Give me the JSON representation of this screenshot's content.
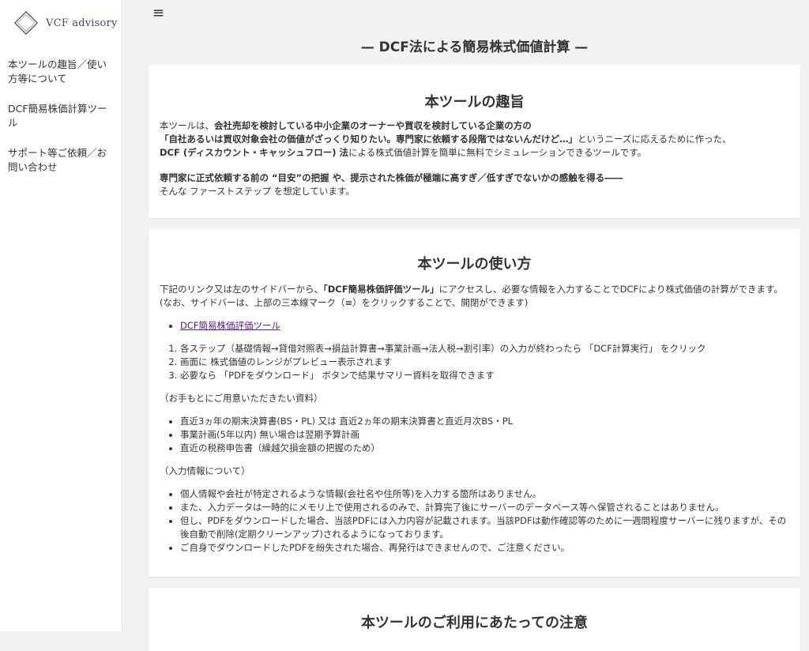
{
  "brand": {
    "name": "VCF advisory"
  },
  "menu_icon": "≡",
  "sidebar": {
    "items": [
      {
        "label": "本ツールの趣旨／使い方等について"
      },
      {
        "label": "DCF簡易株価計算ツール"
      },
      {
        "label": "サポート等ご依頼／お問い合わせ"
      }
    ]
  },
  "page_title": "— DCF法による簡易株式価値計算 —",
  "purpose": {
    "title": "本ツールの趣旨",
    "line1_pre": "本ツールは、",
    "line1_bold": "会社売却を検討している中小企業のオーナーや買収を検討している企業の方の",
    "line2_bold": "「自社あるいは買収対象会社の価値がざっくり知りたい。専門家に依頼する段階ではないんだけど…」",
    "line2_post": "というニーズに応えるために作った、",
    "line3_bold": "DCF (ディスカウント・キャッシュフロー) 法",
    "line3_post": "による株式価値計算を簡単に無料でシミュレーションできるツールです。",
    "note_bold": "専門家に正式依頼する前の “目安”の把握 や、提示された株価が極端に高すぎ／低すぎでないかの感触を得る――",
    "note_line2": "そんな ファーストステップ を想定しています。"
  },
  "howto": {
    "title": "本ツールの使い方",
    "lead_pre": "下記のリンク又は左のサイドバーから、",
    "lead_bold": "「DCF簡易株価評価ツール」",
    "lead_post": "にアクセスし、必要な情報を入力することでDCFにより株式価値の計算ができます。(なお、サイドバーは、上部の三本線マーク（≡）をクリックすることで、開閉ができます)",
    "link_label": "DCF簡易株価評価ツール",
    "steps": [
      "各ステップ（基礎情報→貸借対照表→損益計算書→事業計画→法人税→割引率）の入力が終わったら 「DCF計算実行」 をクリック",
      "画面に 株式価値のレンジがプレビュー表示されます",
      "必要なら 「PDFをダウンロード」 ボタンで結果サマリー資料を取得できます"
    ],
    "materials_heading": "（お手もとにご用意いただきたい資料）",
    "materials": [
      "直近3ヵ年の期末決算書(BS・PL) 又は 直近2ヵ年の期末決算書と直近月次BS・PL",
      "事業計画(5年以内) 無い場合は翌期予算計画",
      "直近の税務申告書（繰越欠損金額の把握のため）"
    ],
    "input_heading": "（入力情報について）",
    "input_notes": [
      "個人情報や会社が特定されるような情報(会社名や住所等)を入力する箇所はありません。",
      "また、入力データは一時的にメモリ上で使用されるのみで、計算完了後にサーバーのデータベース等へ保管されることはありません。",
      "但し、PDFをダウンロードした場合、当該PDFには入力内容が記載されます。当該PDFは動作確認等のために一週間程度サーバーに残りますが、その後自動で削除(定期クリーンアップ)されるようになっております。",
      "ご自身でダウンロードしたPDFを紛失された場合、再発行はできませんので、ご注意ください。"
    ]
  },
  "notice": {
    "title": "本ツールのご利用にあたっての注意"
  }
}
